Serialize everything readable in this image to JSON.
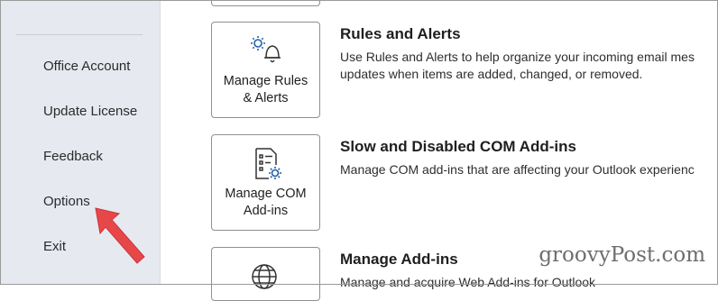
{
  "sidebar": {
    "items": [
      {
        "label": "Office Account"
      },
      {
        "label": "Update License"
      },
      {
        "label": "Feedback"
      },
      {
        "label": "Options"
      },
      {
        "label": "Exit"
      }
    ]
  },
  "main": {
    "sections": [
      {
        "title": "Rules and Alerts",
        "description_line1": "Use Rules and Alerts to help organize your incoming email mes",
        "description_line2": "updates when items are added, changed, or removed.",
        "button_line1": "Manage Rules",
        "button_line2": "& Alerts",
        "icon": "gear-bell-icon"
      },
      {
        "title": "Slow and Disabled COM Add-ins",
        "description_line1": "Manage COM add-ins that are affecting your Outlook experienc",
        "button_line1": "Manage COM",
        "button_line2": "Add-ins",
        "icon": "list-gear-icon"
      },
      {
        "title": "Manage Add-ins",
        "description_line1": "Manage and acquire Web Add-ins for Outlook",
        "icon": "globe-gear-icon"
      }
    ]
  },
  "watermark": "groovyPost.com",
  "annotation": {
    "color": "#e8474a",
    "icon": "arrow-pointer-icon"
  }
}
